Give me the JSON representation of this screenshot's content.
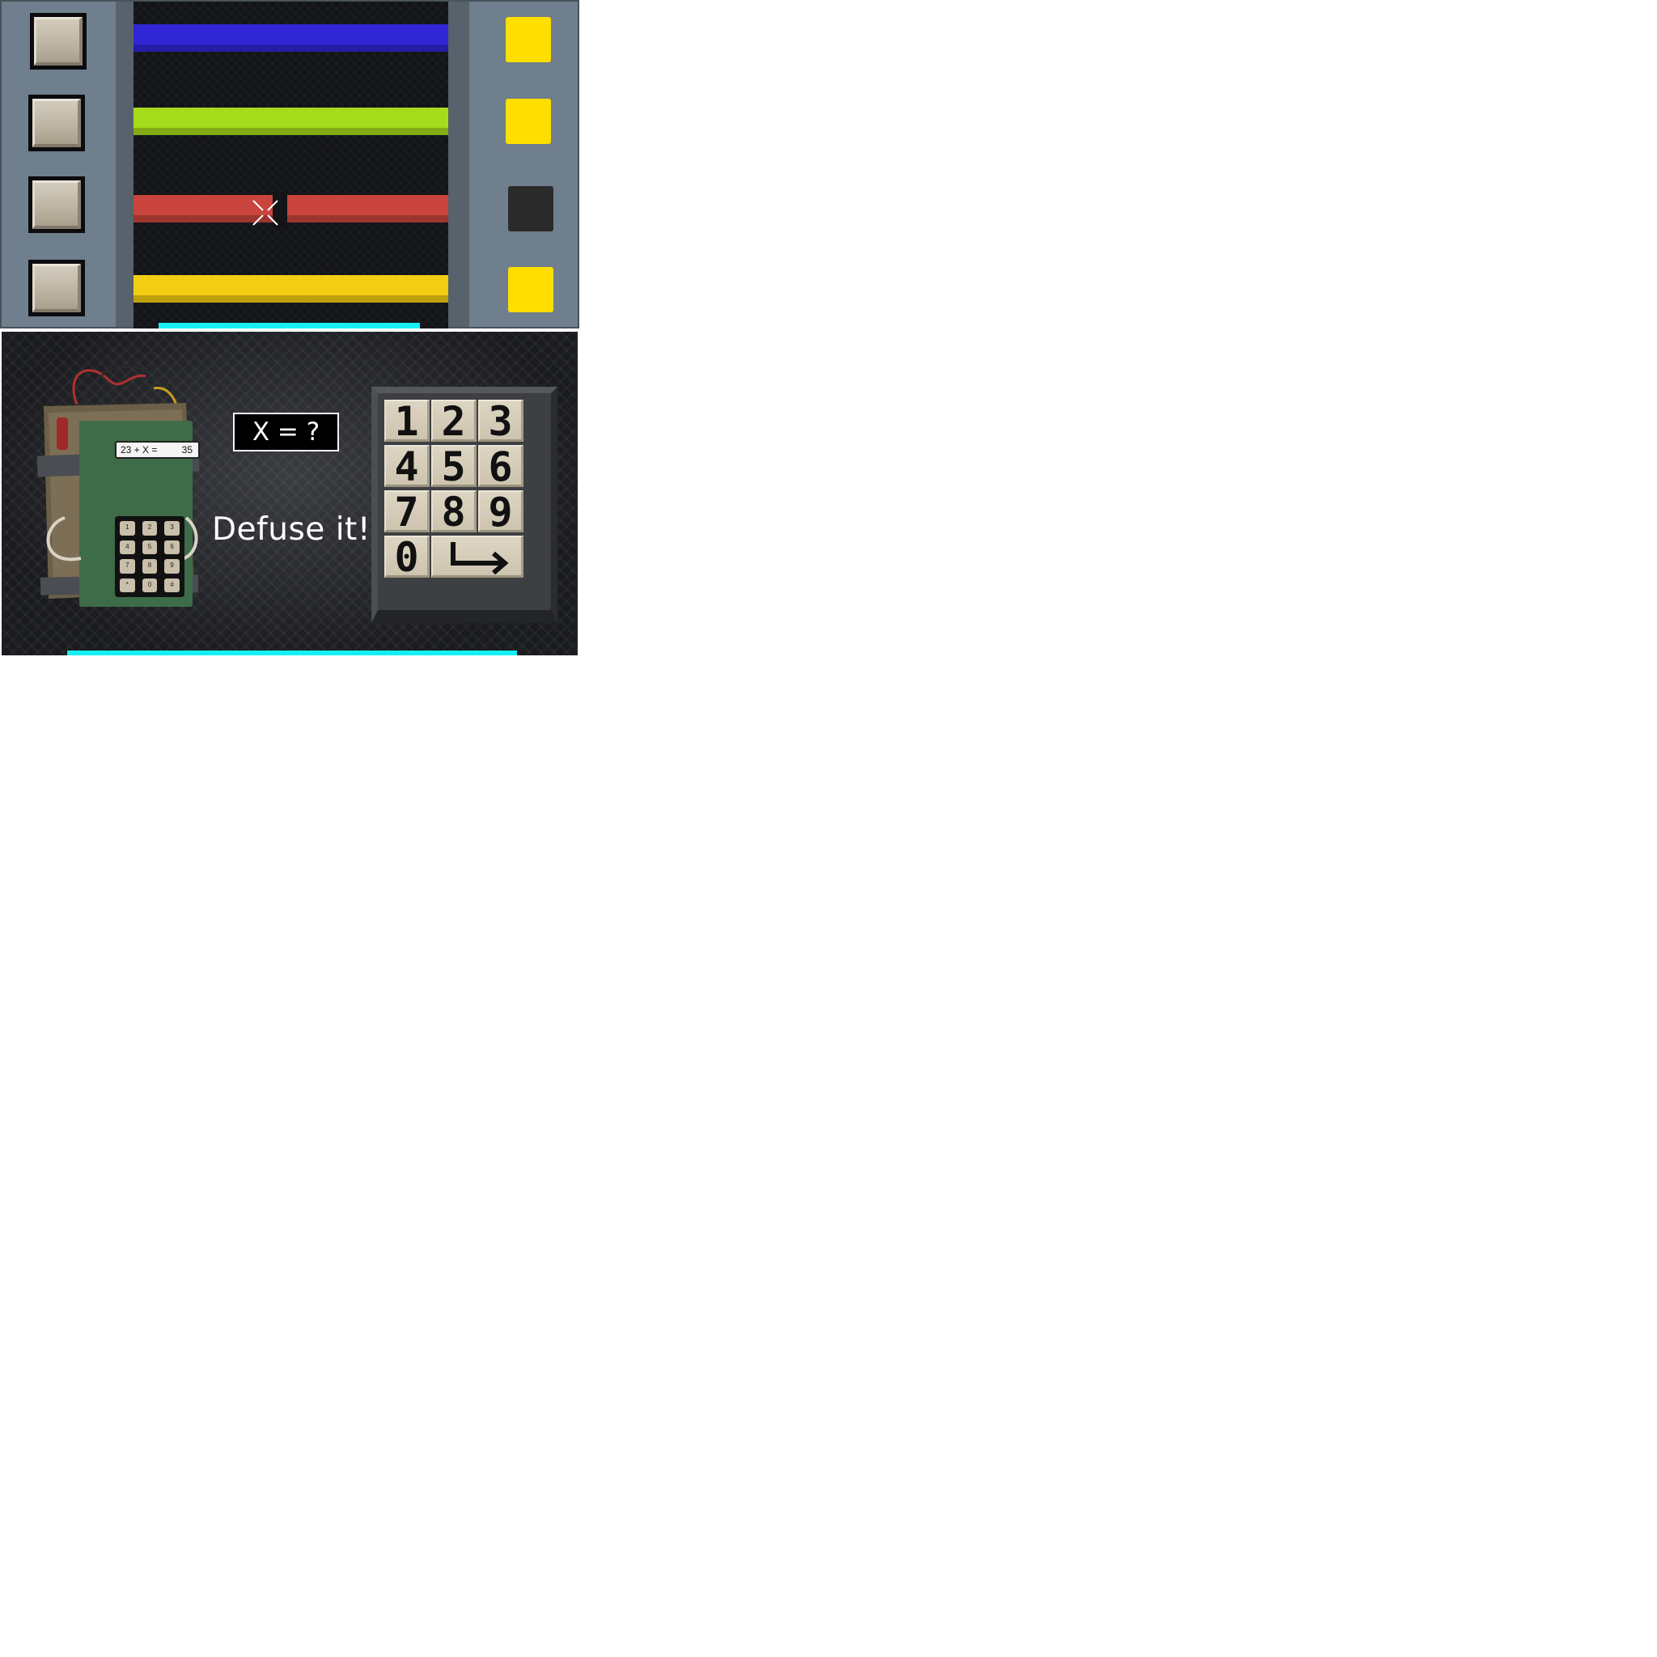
{
  "wires_game": {
    "wires": [
      {
        "color": "#3126d6",
        "state": "intact"
      },
      {
        "color": "#a7dc1c",
        "state": "intact"
      },
      {
        "color": "#c8443c",
        "state": "cut"
      },
      {
        "color": "#f2cd12",
        "state": "intact"
      }
    ],
    "lamps": [
      {
        "color": "#ffde00",
        "state": "on"
      },
      {
        "color": "#ffde00",
        "state": "on"
      },
      {
        "color": "#2a2a2a",
        "state": "off"
      },
      {
        "color": "#ffde00",
        "state": "on"
      }
    ],
    "timer_bar_color": "#14f0f5"
  },
  "defuse_game": {
    "bomb_display": {
      "equation": "23 + X =",
      "target": "35"
    },
    "mini_keypad": [
      "1",
      "2",
      "3",
      "4",
      "5",
      "6",
      "7",
      "8",
      "9",
      "*",
      "0",
      "#"
    ],
    "question": "X = ?",
    "title": "Defuse it!",
    "keypad": {
      "keys": [
        "1",
        "2",
        "3",
        "4",
        "5",
        "6",
        "7",
        "8",
        "9",
        "0"
      ],
      "enter_icon": "enter-arrow-icon"
    },
    "timer_bar_color": "#14f0f5"
  }
}
